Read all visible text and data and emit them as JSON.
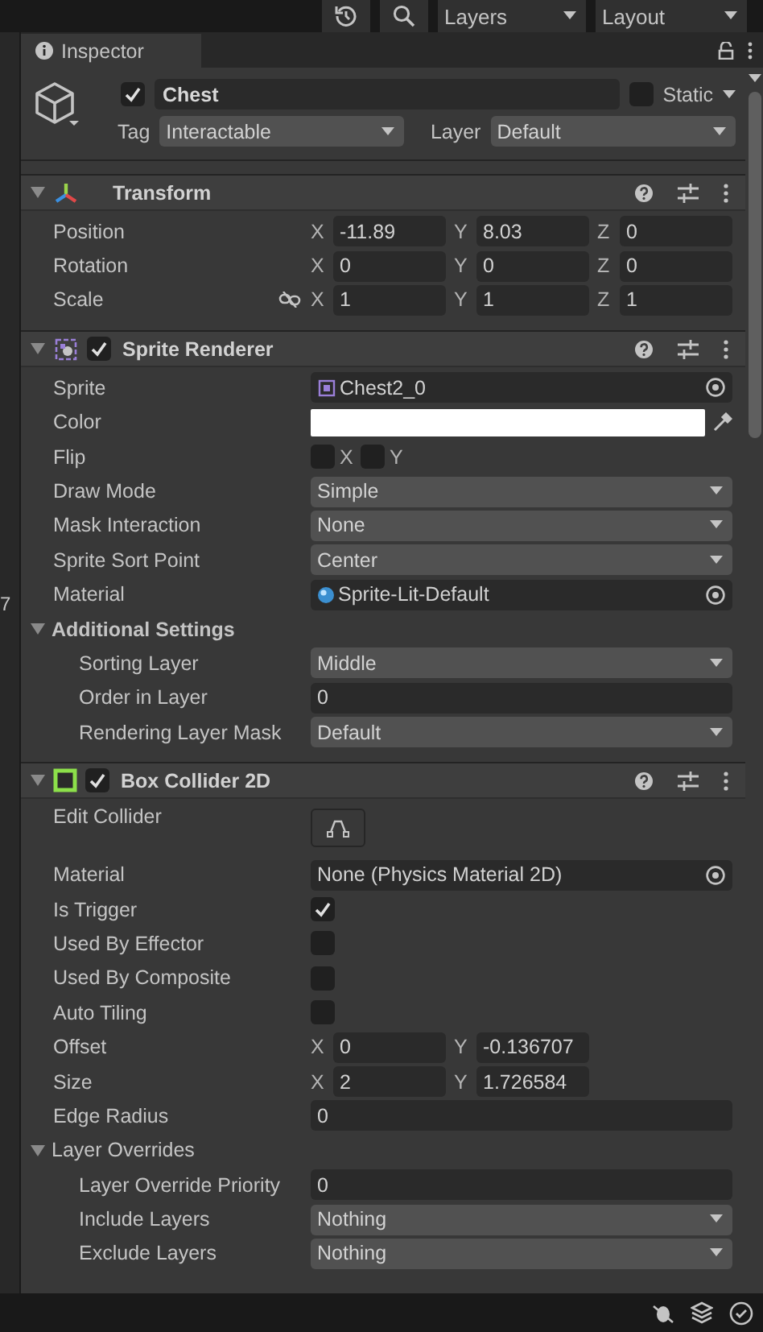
{
  "toolbar": {
    "buttons": [
      {
        "kind": "history"
      },
      {
        "kind": "search"
      }
    ],
    "dropdowns": [
      {
        "label": "Layers"
      },
      {
        "label": "Layout"
      }
    ]
  },
  "left_panel": {
    "text": "7"
  },
  "tab": {
    "label": "Inspector",
    "selected": true
  },
  "game_object": {
    "active": true,
    "name": "Chest",
    "static": false,
    "static_label": "Static",
    "tag_label": "Tag",
    "tag": "Interactable",
    "layer_label": "Layer",
    "layer": "Default"
  },
  "components": [
    {
      "name": "Transform",
      "expanded": true,
      "rows": [
        {
          "kind": "vector",
          "label": "Position",
          "axes": [
            {
              "axis": "X",
              "value": "-11.89"
            },
            {
              "axis": "Y",
              "value": "8.03"
            },
            {
              "axis": "Z",
              "value": "0"
            }
          ]
        },
        {
          "kind": "vector",
          "label": "Rotation",
          "axes": [
            {
              "axis": "X",
              "value": "0"
            },
            {
              "axis": "Y",
              "value": "0"
            },
            {
              "axis": "Z",
              "value": "0"
            }
          ]
        },
        {
          "kind": "vector",
          "label": "Scale",
          "constrain_proportions": false,
          "axes": [
            {
              "axis": "X",
              "value": "1"
            },
            {
              "axis": "Y",
              "value": "1"
            },
            {
              "axis": "Z",
              "value": "1"
            }
          ]
        }
      ]
    },
    {
      "name": "Sprite Renderer",
      "enabled": true,
      "expanded": true,
      "rows": [
        {
          "kind": "sprite",
          "label": "Sprite",
          "value": "Chest2_0"
        },
        {
          "kind": "color",
          "label": "Color",
          "color": "#ffffff"
        },
        {
          "kind": "toggles",
          "label": "Flip",
          "toggles": [
            {
              "label": "X",
              "checked": false
            },
            {
              "label": "Y",
              "checked": false
            }
          ]
        },
        {
          "kind": "dropdown",
          "label": "Draw Mode",
          "value": "Simple"
        },
        {
          "kind": "dropdown",
          "label": "Mask Interaction",
          "value": "None"
        },
        {
          "kind": "dropdown",
          "label": "Sprite Sort Point",
          "value": "Center"
        },
        {
          "kind": "material",
          "label": "Material",
          "value": "Sprite-Lit-Default"
        },
        {
          "kind": "foldout",
          "label": "Additional Settings",
          "bold": true,
          "expanded": true,
          "children": [
            {
              "kind": "dropdown",
              "label": "Sorting Layer",
              "value": "Middle"
            },
            {
              "kind": "field",
              "label": "Order in Layer",
              "value": "0"
            },
            {
              "kind": "dropdown",
              "label": "Rendering Layer Mask",
              "value": "Default"
            }
          ]
        }
      ]
    },
    {
      "name": "Box Collider 2D",
      "enabled": true,
      "expanded": true,
      "rows": [
        {
          "kind": "button",
          "label": "Edit Collider"
        },
        {
          "kind": "object",
          "label": "Material",
          "value": "None (Physics Material 2D)"
        },
        {
          "kind": "checkbox",
          "label": "Is Trigger",
          "checked": true
        },
        {
          "kind": "checkbox",
          "label": "Used By Effector",
          "checked": false
        },
        {
          "kind": "checkbox",
          "label": "Used By Composite",
          "checked": false
        },
        {
          "kind": "checkbox",
          "label": "Auto Tiling",
          "checked": false
        },
        {
          "kind": "vector",
          "label": "Offset",
          "axes": [
            {
              "axis": "X",
              "value": "0"
            },
            {
              "axis": "Y",
              "value": "-0.136707"
            }
          ]
        },
        {
          "kind": "vector",
          "label": "Size",
          "axes": [
            {
              "axis": "X",
              "value": "2"
            },
            {
              "axis": "Y",
              "value": "1.726584"
            }
          ]
        },
        {
          "kind": "field",
          "label": "Edge Radius",
          "value": "0"
        },
        {
          "kind": "foldout",
          "label": "Layer Overrides",
          "bold": false,
          "expanded": true,
          "children": [
            {
              "kind": "field",
              "label": "Layer Override Priority",
              "value": "0"
            },
            {
              "kind": "dropdown",
              "label": "Include Layers",
              "value": "Nothing"
            },
            {
              "kind": "dropdown",
              "label": "Exclude Layers",
              "value": "Nothing"
            }
          ]
        }
      ]
    }
  ]
}
